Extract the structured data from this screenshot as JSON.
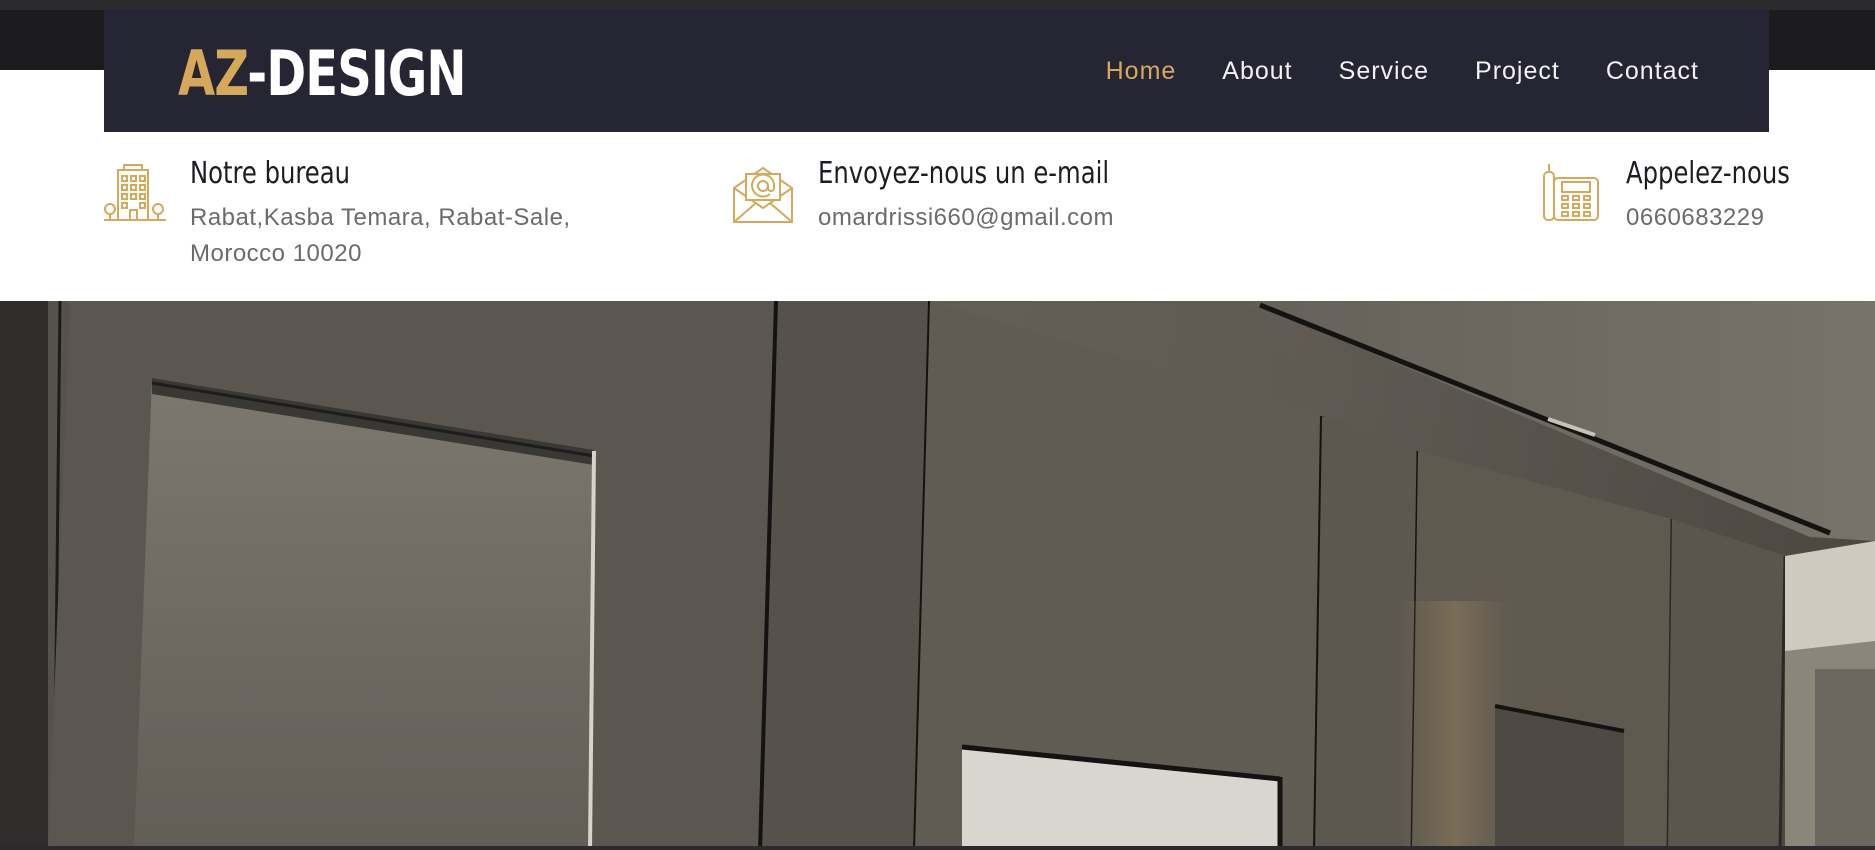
{
  "brand": {
    "logo_accent": "AZ",
    "logo_main": "-DESIGN",
    "accent_color": "#d6a95a",
    "navbar_color": "#252533"
  },
  "nav": {
    "items": [
      {
        "label": "Home",
        "active": true
      },
      {
        "label": "About",
        "active": false
      },
      {
        "label": "Service",
        "active": false
      },
      {
        "label": "Project",
        "active": false
      },
      {
        "label": "Contact",
        "active": false
      }
    ]
  },
  "info": {
    "office": {
      "icon": "building-icon",
      "title": "Notre bureau",
      "text": "Rabat,Kasba Temara, Rabat-Sale, Morocco 10020"
    },
    "email": {
      "icon": "email-icon",
      "title": "Envoyez-nous un e-mail",
      "text": "omardrissi660@gmail.com"
    },
    "phone": {
      "icon": "phone-icon",
      "title": "Appelez-nous",
      "text": "0660683229"
    }
  },
  "hero": {
    "image": "interior-wall-panels-photo"
  }
}
